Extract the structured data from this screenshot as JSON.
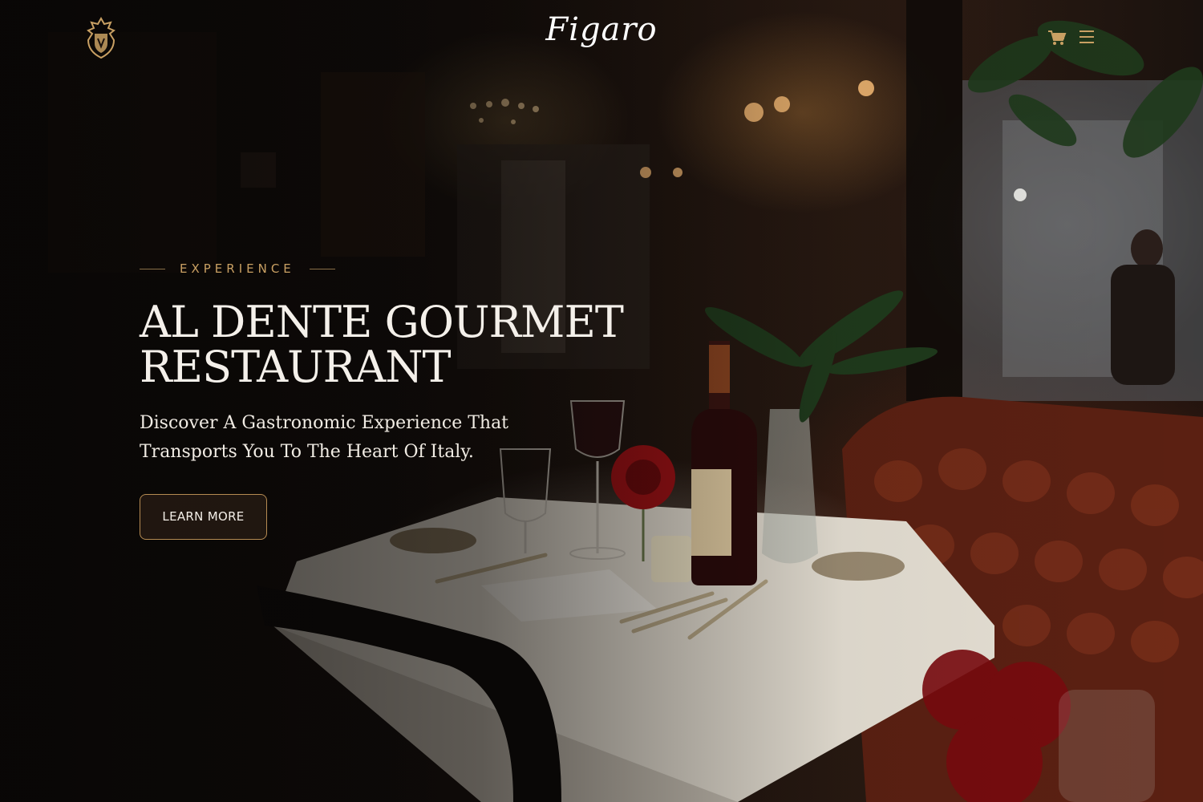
{
  "header": {
    "brand": "Figaro",
    "crest_icon": "crest-logo-icon",
    "cart_icon": "cart-icon",
    "menu_icon": "hamburger-menu-icon"
  },
  "hero": {
    "eyebrow": "EXPERIENCE",
    "title_line1": "AL DENTE GOURMET",
    "title_line2": "RESTAURANT",
    "subtitle": "Discover A Gastronomic Experience That Transports You To The Heart Of Italy.",
    "cta_label": "LEARN MORE"
  },
  "colors": {
    "accent_gold": "#c9a063",
    "text_light": "#f4f0ea",
    "background_dark": "#0f0b09"
  }
}
